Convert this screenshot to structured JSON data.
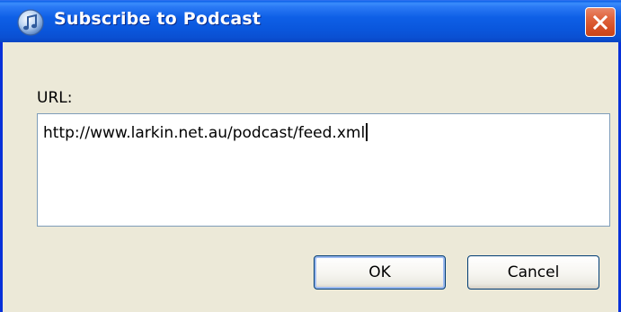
{
  "window": {
    "title": "Subscribe to Podcast",
    "app_icon": "itunes-icon",
    "close_icon": "close-icon"
  },
  "form": {
    "url_label": "URL:",
    "url_value": "http://www.larkin.net.au/podcast/feed.xml"
  },
  "buttons": {
    "ok_label": "OK",
    "cancel_label": "Cancel"
  },
  "colors": {
    "titlebar": "#0a5ee8",
    "frame": "#0831d9",
    "body": "#ece9d8",
    "close_button": "#d54f26",
    "input_border": "#7f9db9"
  }
}
